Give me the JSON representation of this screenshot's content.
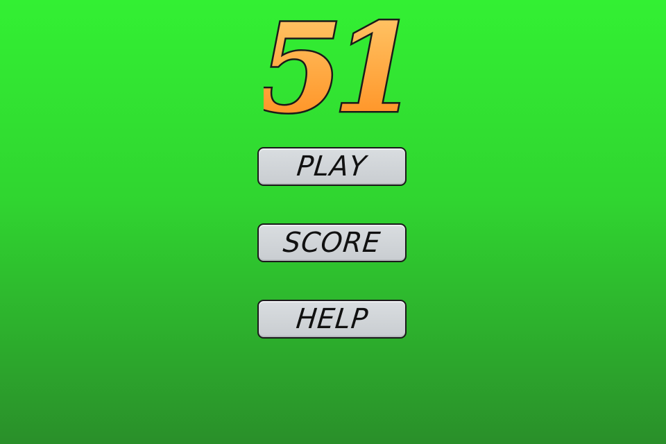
{
  "title": {
    "text": "51",
    "gradient_top": "#ffcc70",
    "gradient_bottom": "#ff8a1a",
    "outline": "#1a1a1a"
  },
  "menu": {
    "buttons": [
      {
        "id": "play",
        "label": "PLAY"
      },
      {
        "id": "score",
        "label": "SCORE"
      },
      {
        "id": "help",
        "label": "HELP"
      }
    ]
  },
  "colors": {
    "background_top": "#33f033",
    "background_bottom": "#2a8f2a",
    "button_face": "#d2d6da",
    "button_text": "#111111"
  }
}
